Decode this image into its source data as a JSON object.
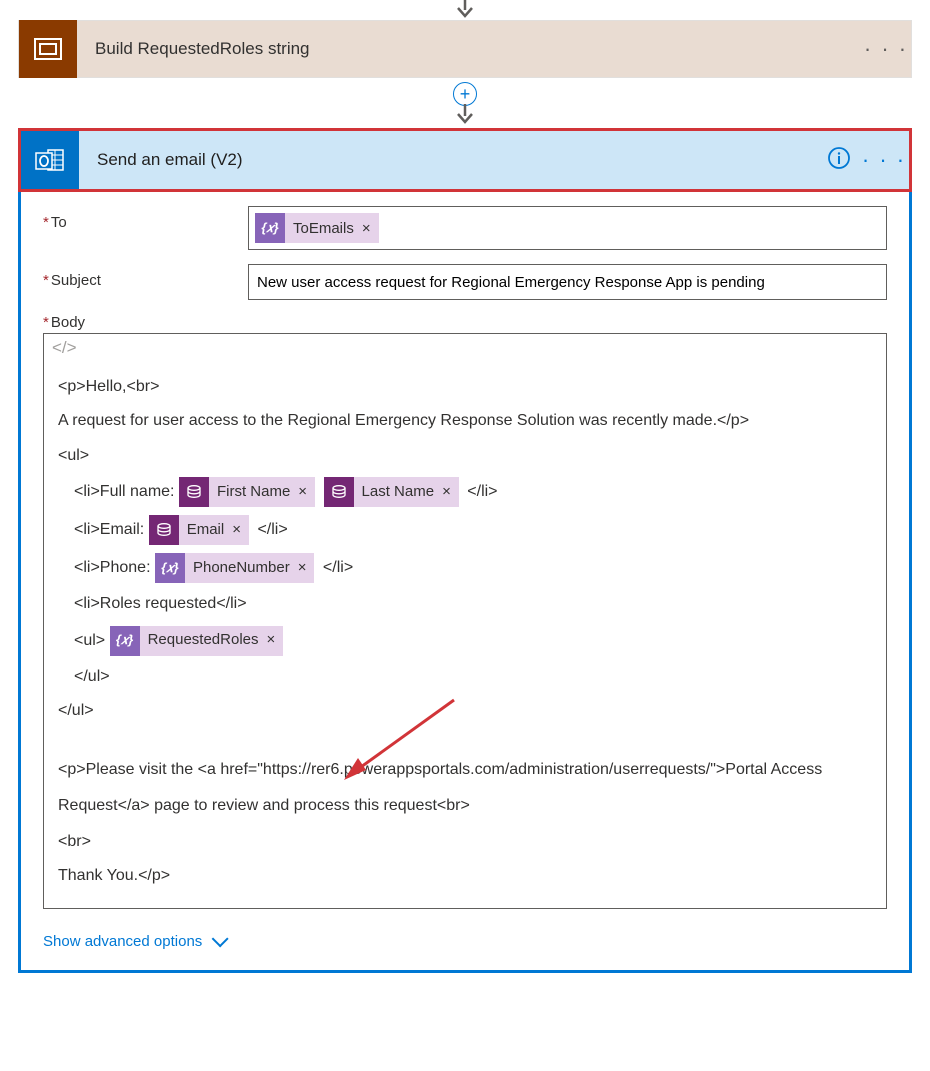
{
  "step1": {
    "title": "Build RequestedRoles string"
  },
  "step2": {
    "title": "Send an email (V2)",
    "fields": {
      "to_label": "To",
      "subject_label": "Subject",
      "body_label": "Body",
      "subject_value": "New user access request for Regional Emergency Response App is pending"
    },
    "tokens": {
      "to_emails": "ToEmails",
      "first_name": "First Name",
      "last_name": "Last Name",
      "email": "Email",
      "phone": "PhoneNumber",
      "requested_roles": "RequestedRoles"
    },
    "body": {
      "l1": "<p>Hello,<br>",
      "l2": "A request for user access to the Regional Emergency Response Solution was recently made.</p>",
      "l3": "<ul>",
      "l4a": "<li>Full name:",
      "l4b": "</li>",
      "l5a": "<li>Email:",
      "l5b": "</li>",
      "l6a": "<li>Phone:",
      "l6b": "</li>",
      "l7": "<li>Roles requested</li>",
      "l8a": "<ul>",
      "l9": "</ul>",
      "l10": "</ul>",
      "l11": "<p>Please visit the <a href=\"https://rer6.powerappsportals.com/administration/userrequests/\">Portal Access Request</a> page to review and process this request<br>",
      "l12": "<br>",
      "l13": "Thank You.</p>"
    },
    "code_toggle": "</>",
    "show_advanced": "Show advanced options"
  },
  "glyphs": {
    "fx": "{𝑥}",
    "close_x": "×",
    "ellipsis": "· · ·",
    "plus": "+"
  }
}
